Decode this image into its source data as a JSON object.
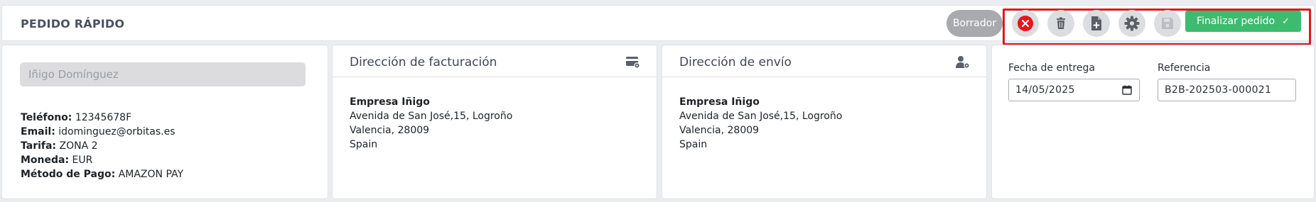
{
  "header": {
    "title": "PEDIDO RÁPIDO",
    "status_badge": "Borrador",
    "actions": [
      {
        "name": "cancel",
        "icon": "close-circle-icon",
        "color": "#e8141c"
      },
      {
        "name": "delete",
        "icon": "trash-icon",
        "color": "#5a5f68"
      },
      {
        "name": "new-document",
        "icon": "file-plus-icon",
        "color": "#5a5f68"
      },
      {
        "name": "settings",
        "icon": "gear-icon",
        "color": "#5a5f68"
      },
      {
        "name": "save",
        "icon": "save-icon",
        "color": "#b9bcc1"
      }
    ],
    "finalize_label": "Finalizar pedido",
    "finalize_color": "#3dbb6f",
    "highlight_color": "#e0171f"
  },
  "customer": {
    "selected_name": "Iñigo Domínguez",
    "fields": [
      {
        "label": "Teléfono:",
        "value": "12345678F"
      },
      {
        "label": "Email:",
        "value": "idominguez@orbitas.es"
      },
      {
        "label": "Tarifa:",
        "value": "ZONA 2"
      },
      {
        "label": "Moneda:",
        "value": "EUR"
      },
      {
        "label": "Método de Pago:",
        "value": "AMAZON PAY"
      }
    ]
  },
  "billing": {
    "title": "Dirección de facturación",
    "icon": "card-settings-icon",
    "company": "Empresa Iñigo",
    "line1": "Avenida de San José,15, Logroño",
    "line2": "Valencia, 28009",
    "country": "Spain"
  },
  "shipping": {
    "title": "Dirección de envío",
    "icon": "user-settings-icon",
    "company": "Empresa Iñigo",
    "line1": "Avenida de San José,15, Logroño",
    "line2": "Valencia, 28009",
    "country": "Spain"
  },
  "order": {
    "delivery_label": "Fecha de entrega",
    "delivery_value": "14/05/2025",
    "reference_label": "Referencia",
    "reference_value": "B2B-202503-000021"
  }
}
